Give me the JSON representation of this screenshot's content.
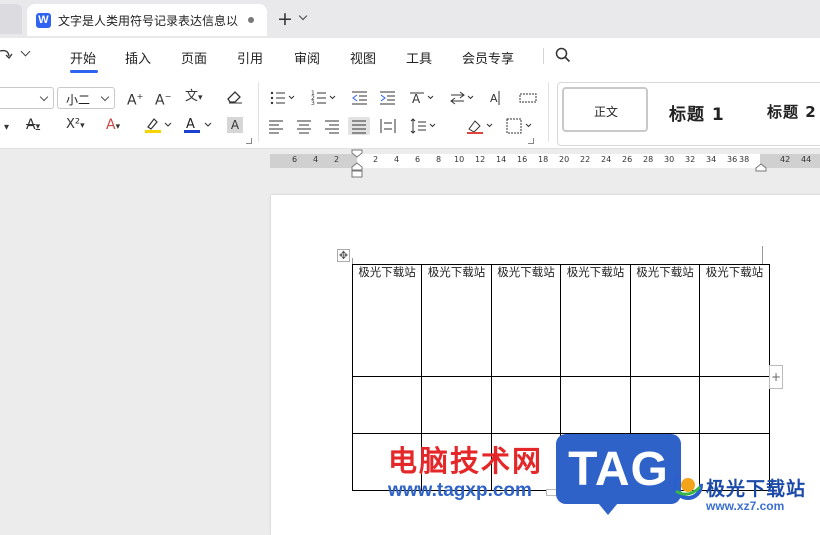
{
  "tab": {
    "app_icon_letter": "W",
    "title": "文字是人类用符号记录表达信息以"
  },
  "menu": {
    "items": [
      {
        "label": "开始",
        "active": true
      },
      {
        "label": "插入",
        "active": false
      },
      {
        "label": "页面",
        "active": false
      },
      {
        "label": "引用",
        "active": false
      },
      {
        "label": "审阅",
        "active": false
      },
      {
        "label": "视图",
        "active": false
      },
      {
        "label": "工具",
        "active": false
      },
      {
        "label": "会员专享",
        "active": false
      }
    ],
    "accent_color": "#2e63f2"
  },
  "ribbon": {
    "font_size_value": "小二",
    "grow_font_label": "A",
    "shrink_font_label": "A",
    "pinyin_label": "文",
    "strikethrough_label": "A",
    "superscript_label": "X²",
    "text_effect_label": "A",
    "highlight_color": "#f5d400",
    "font_color": "#1f3fcf",
    "char_shading_label": "A",
    "styles": {
      "normal": "正文",
      "heading1": "标题 1",
      "heading2": "标题 2"
    }
  },
  "ruler": {
    "ticks": [
      "6",
      "4",
      "2",
      "2",
      "4",
      "6",
      "8",
      "10",
      "12",
      "14",
      "16",
      "18",
      "20",
      "22",
      "24",
      "26",
      "28",
      "30",
      "32",
      "34",
      "36",
      "38",
      "42",
      "44"
    ]
  },
  "document": {
    "table": {
      "rows": [
        [
          "极光下载站",
          "极光下载站",
          "极光下载站",
          "极光下载站",
          "极光下载站",
          "极光下载站"
        ],
        [
          "",
          "",
          "",
          "",
          "",
          ""
        ],
        [
          "",
          "",
          "",
          "",
          "",
          ""
        ]
      ]
    }
  },
  "watermark": {
    "site_name": "电脑技术网",
    "site_url": "www.tagxp.com",
    "tag_logo": "TAG",
    "brand_name": "极光下载站",
    "brand_url": "www.xz7.com"
  }
}
